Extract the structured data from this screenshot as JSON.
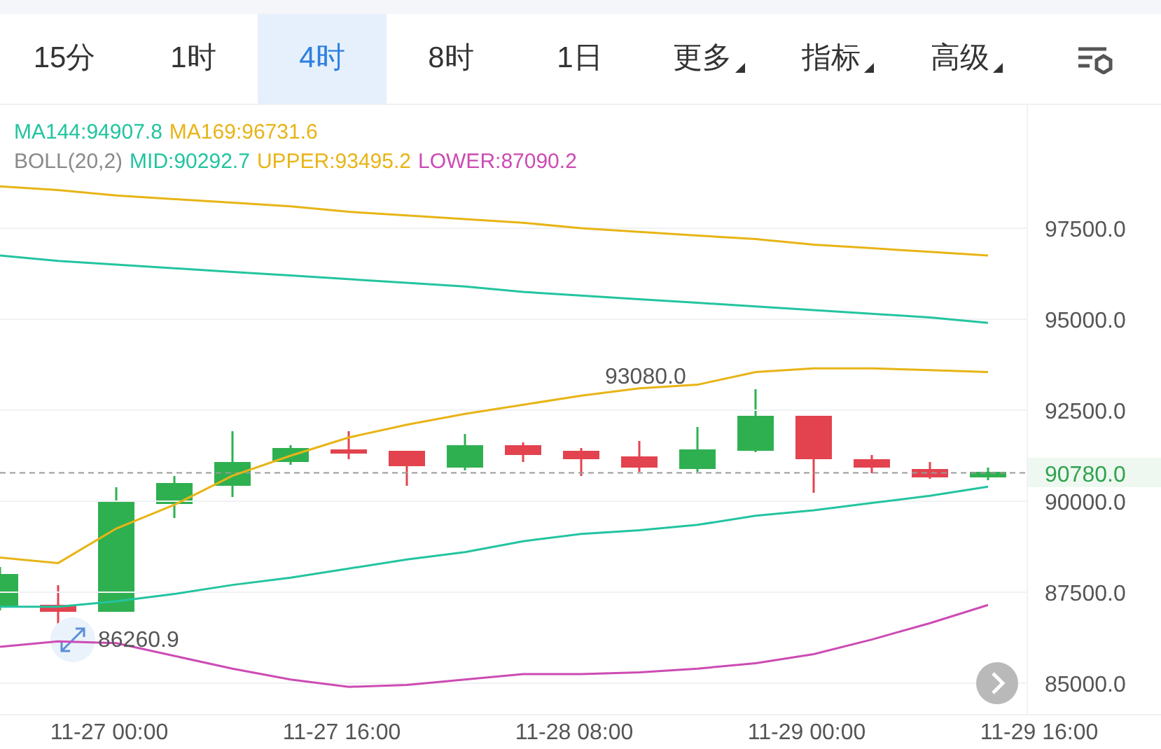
{
  "tabs": [
    {
      "label": "15分",
      "selected": false,
      "dropdown": false
    },
    {
      "label": "1时",
      "selected": false,
      "dropdown": false
    },
    {
      "label": "4时",
      "selected": true,
      "dropdown": false
    },
    {
      "label": "8时",
      "selected": false,
      "dropdown": false
    },
    {
      "label": "1日",
      "selected": false,
      "dropdown": false
    },
    {
      "label": "更多",
      "selected": false,
      "dropdown": true
    },
    {
      "label": "指标",
      "selected": false,
      "dropdown": true
    },
    {
      "label": "高级",
      "selected": false,
      "dropdown": true
    }
  ],
  "legend": [
    [
      {
        "text": "MA144:94907.8",
        "color": "#23c4a0"
      },
      {
        "text": "MA169:96731.6",
        "color": "#e8b416"
      }
    ],
    [
      {
        "text": "BOLL(20,2)",
        "color": "#8a8a8a"
      },
      {
        "text": "MID:90292.7",
        "color": "#23c4a0"
      },
      {
        "text": "UPPER:93495.2",
        "color": "#e8b416"
      },
      {
        "text": "LOWER:87090.2",
        "color": "#cc4bb4"
      }
    ]
  ],
  "high_label": "93080.0",
  "low_label": "86260.9",
  "current_price": "90780.0",
  "chart_data": {
    "type": "line",
    "categories": [
      null,
      null,
      "11-27 00:00",
      null,
      null,
      null,
      "11-27 16:00",
      null,
      null,
      null,
      "11-28 08:00",
      null,
      null,
      null,
      "11-29 00:00",
      null,
      null,
      null,
      "11-29 16:00"
    ],
    "yticks": [
      {
        "value": 97500,
        "label": "97500.0"
      },
      {
        "value": 95000,
        "label": "95000.0"
      },
      {
        "value": 92500,
        "label": "92500.0"
      },
      {
        "value": 90000,
        "label": "90000.0"
      },
      {
        "value": 87500,
        "label": "87500.0"
      },
      {
        "value": 85000,
        "label": "85000.0"
      }
    ],
    "ylim": [
      84154,
      100885
    ],
    "grid": true,
    "ref_lines": [
      {
        "axis": "y",
        "value": 90780
      }
    ],
    "series": [
      {
        "color": "#e8b416",
        "values": [
          98650,
          98550,
          98400,
          98300,
          98200,
          98100,
          97950,
          97850,
          97750,
          97650,
          97500,
          97400,
          97300,
          97200,
          97050,
          96950,
          96850,
          96750,
          null
        ]
      },
      {
        "color": "#23c4a0",
        "values": [
          96750,
          96600,
          96500,
          96400,
          96300,
          96200,
          96100,
          96000,
          95900,
          95750,
          95650,
          95550,
          95450,
          95350,
          95250,
          95150,
          95050,
          94900,
          null
        ]
      },
      {
        "color": "#e8b416",
        "values": [
          88450,
          88300,
          89250,
          89900,
          90700,
          91250,
          91750,
          92100,
          92400,
          92650,
          92900,
          93100,
          93200,
          93550,
          93650,
          93650,
          93600,
          93550,
          null
        ]
      },
      {
        "color": "#23c4a0",
        "values": [
          87100,
          87100,
          87250,
          87450,
          87700,
          87900,
          88150,
          88400,
          88600,
          88900,
          89100,
          89200,
          89350,
          89600,
          89750,
          89950,
          90150,
          90400,
          null
        ]
      },
      {
        "color": "#cc4bb4",
        "values": [
          86000,
          86150,
          86100,
          85750,
          85400,
          85100,
          84900,
          84950,
          85100,
          85250,
          85250,
          85300,
          85400,
          85550,
          85800,
          86200,
          86650,
          87150,
          null
        ]
      }
    ]
  }
}
